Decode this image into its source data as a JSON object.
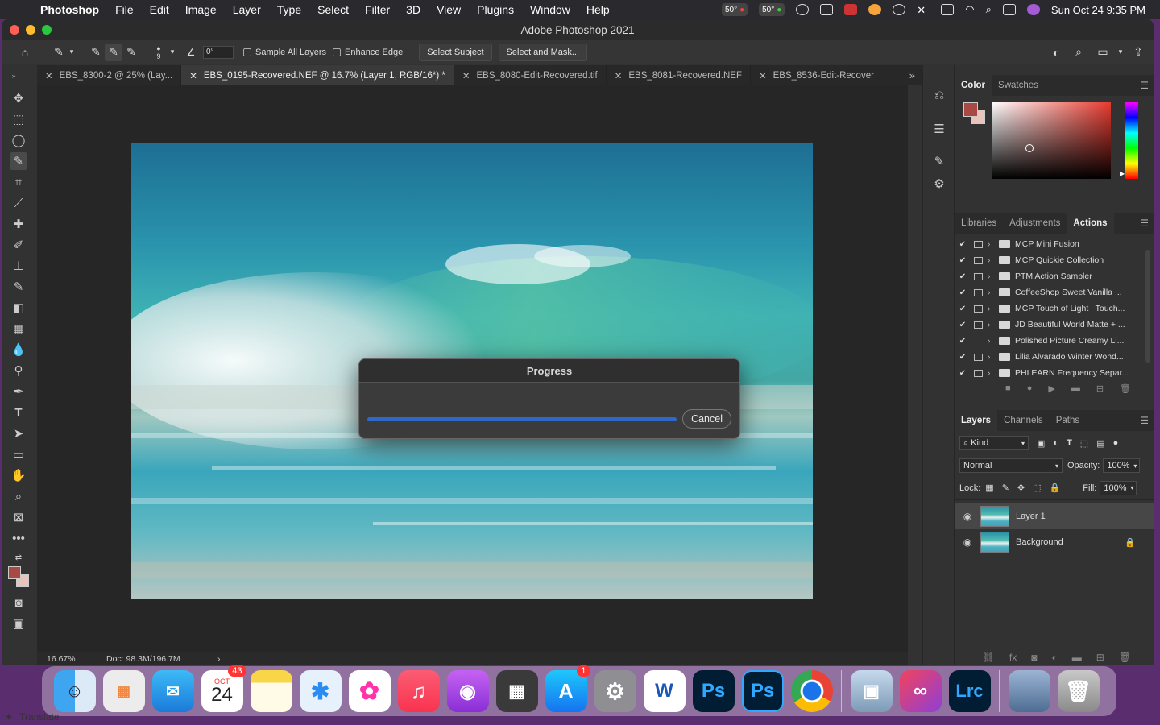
{
  "menubar": {
    "app_name": "Photoshop",
    "items": [
      "File",
      "Edit",
      "Image",
      "Layer",
      "Type",
      "Select",
      "Filter",
      "3D",
      "View",
      "Plugins",
      "Window",
      "Help"
    ],
    "temp1": "50°",
    "temp2": "50°",
    "datetime": "Sun Oct 24  9:35 PM"
  },
  "window": {
    "title": "Adobe Photoshop 2021"
  },
  "options": {
    "brush_size": "9",
    "angle": "0°",
    "sample_all_layers": "Sample All Layers",
    "enhance_edge": "Enhance Edge",
    "select_subject": "Select Subject",
    "select_and_mask": "Select and Mask..."
  },
  "tabs": [
    {
      "label": "EBS_8300-2 @ 25% (Lay..."
    },
    {
      "label": "EBS_0195-Recovered.NEF @ 16.7% (Layer 1, RGB/16*) *"
    },
    {
      "label": "EBS_8080-Edit-Recovered.tif"
    },
    {
      "label": "EBS_8081-Recovered.NEF"
    },
    {
      "label": "EBS_8536-Edit-Recover"
    }
  ],
  "status": {
    "zoom": "16.67%",
    "doc": "Doc: 98.3M/196.7M"
  },
  "color_panel": {
    "tabs": [
      "Color",
      "Swatches"
    ],
    "foreground": "#a84a43",
    "background": "#e8c4bc"
  },
  "actions_panel": {
    "tabs": [
      "Libraries",
      "Adjustments",
      "Actions"
    ],
    "items": [
      {
        "name": "MCP Mini Fusion",
        "checked": "✔"
      },
      {
        "name": "MCP Quickie Collection",
        "checked": "✔"
      },
      {
        "name": "PTM Action Sampler",
        "checked": "✔"
      },
      {
        "name": "CoffeeShop Sweet Vanilla ...",
        "checked": "✔"
      },
      {
        "name": "MCP Touch of Light | Touch...",
        "checked": "✔"
      },
      {
        "name": "JD Beautiful World Matte + ...",
        "checked": "✔"
      },
      {
        "name": "Polished Picture Creamy Li...",
        "checked": "✔"
      },
      {
        "name": "Lilia Alvarado Winter Wond...",
        "checked": "✔"
      },
      {
        "name": "PHLEARN Frequency Separ...",
        "checked": "✔"
      }
    ]
  },
  "layers_panel": {
    "tabs": [
      "Layers",
      "Channels",
      "Paths"
    ],
    "filter": "Kind",
    "blend_mode": "Normal",
    "opacity_label": "Opacity:",
    "opacity": "100%",
    "lock_label": "Lock:",
    "fill_label": "Fill:",
    "fill": "100%",
    "layers": [
      {
        "name": "Layer 1"
      },
      {
        "name": "Background"
      }
    ]
  },
  "progress": {
    "title": "Progress",
    "cancel": "Cancel",
    "fraction": 1.0
  },
  "dock": {
    "calendar_month": "OCT",
    "calendar_day": "24",
    "calendar_badge": "43",
    "appstore_badge": "1",
    "apps": [
      "Finder",
      "Launchpad",
      "Mail",
      "Calendar",
      "Notes",
      "Safari",
      "Photos",
      "Music",
      "Podcasts",
      "Calculator",
      "App Store",
      "System Preferences",
      "Word",
      "Ps",
      "Ps",
      "Chrome",
      "Preview",
      "Creative Cloud",
      "Lrc"
    ]
  },
  "bottom": {
    "translate": "Translate"
  }
}
